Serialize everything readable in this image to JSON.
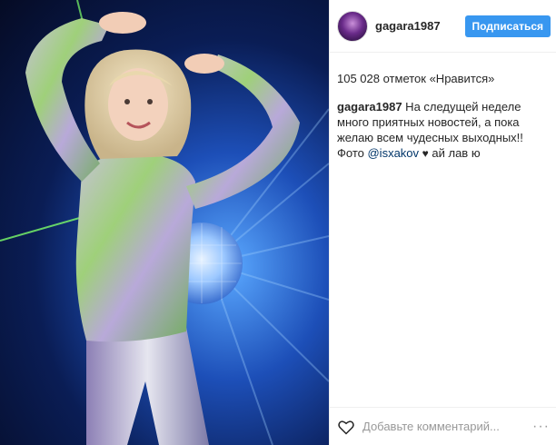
{
  "post": {
    "author": {
      "username": "gagara1987"
    },
    "follow_label": "Подписаться",
    "likes_text": "105 028 отметок «Нравится»",
    "caption": {
      "username": "gagara1987",
      "text_part1": " На следущей неделе много приятных новостей, а пока желаю всем чудесных выходных!! Фото ",
      "mention": "@isxakov",
      "heart": "♥",
      "text_part2": " ай лав ю"
    },
    "comment": {
      "placeholder": "Добавьте комментарий...",
      "more": "···"
    },
    "icons": {
      "like": "heart-outline-icon",
      "more": "more-dots-icon"
    },
    "colors": {
      "follow_button": "#3897f0",
      "mention": "#003569"
    }
  }
}
